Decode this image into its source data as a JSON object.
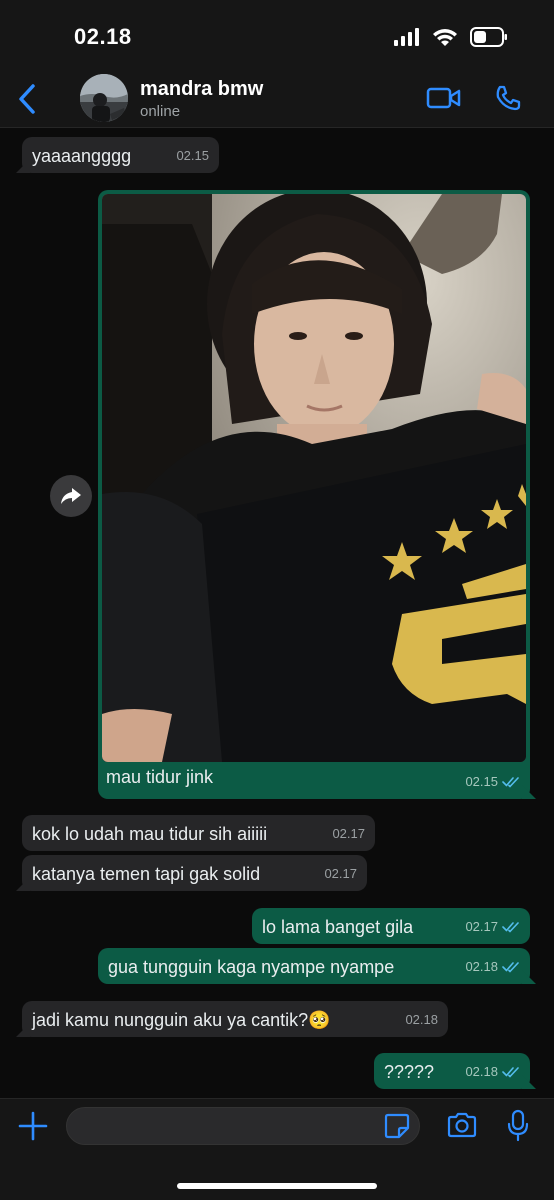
{
  "status_bar": {
    "time": "02.18"
  },
  "header": {
    "contact_name": "mandra bmw",
    "contact_status": "online"
  },
  "messages": [
    {
      "id": "m1",
      "direction": "in",
      "text": "yaaaangggg",
      "time": "02.15"
    },
    {
      "id": "m2",
      "direction": "out",
      "type": "image",
      "caption": "mau tidur jink",
      "time": "02.15",
      "read": true
    },
    {
      "id": "m3",
      "direction": "in",
      "text": "kok lo udah mau tidur sih aiiiii",
      "time": "02.17"
    },
    {
      "id": "m4",
      "direction": "in",
      "text": "katanya temen tapi gak solid",
      "time": "02.17"
    },
    {
      "id": "m5",
      "direction": "out",
      "text": "lo lama banget gila",
      "time": "02.17",
      "read": true
    },
    {
      "id": "m6",
      "direction": "out",
      "text": "gua tungguin kaga nyampe nyampe",
      "time": "02.18",
      "read": true
    },
    {
      "id": "m7",
      "direction": "in",
      "text": "jadi kamu nungguin aku ya cantik?🥺",
      "time": "02.18"
    },
    {
      "id": "m8",
      "direction": "out",
      "text": "?????",
      "time": "02.18",
      "read": true
    }
  ],
  "input": {
    "value": "",
    "placeholder": ""
  },
  "colors": {
    "accent": "#2f8cff",
    "outgoing_bubble": "#0c5b45",
    "incoming_bubble": "#262628",
    "read_ticks": "#53bdeb"
  },
  "icons": [
    "back-chevron-icon",
    "video-call-icon",
    "phone-icon",
    "forward-icon",
    "plus-icon",
    "sticker-icon",
    "camera-icon",
    "microphone-icon"
  ]
}
